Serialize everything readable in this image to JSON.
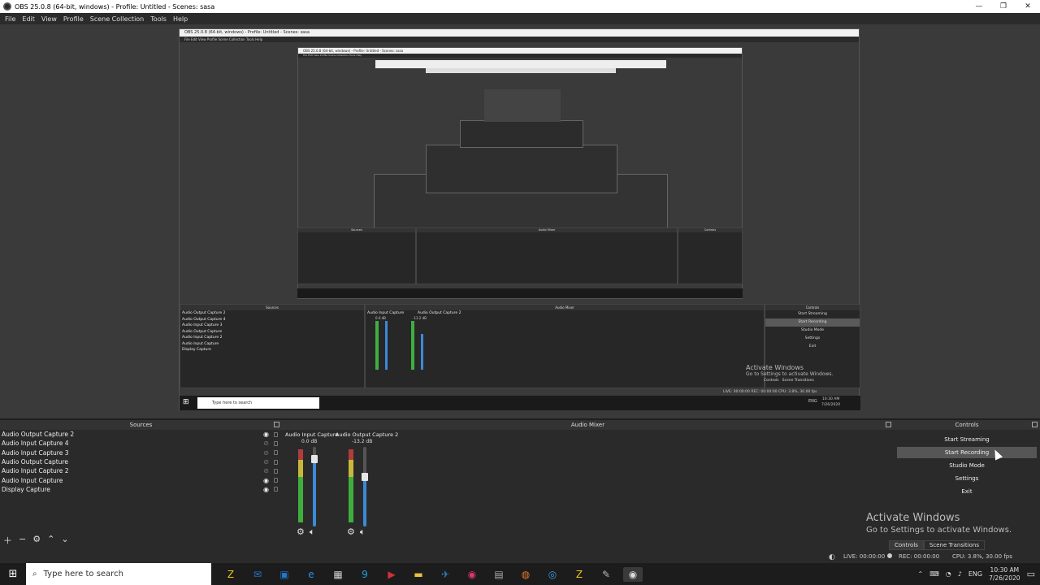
{
  "window": {
    "title": "OBS 25.0.8 (64-bit, windows) - Profile: Untitled - Scenes: sasa",
    "controls": [
      "—",
      "❐",
      "✕"
    ]
  },
  "menu": [
    "File",
    "Edit",
    "View",
    "Profile",
    "Scene Collection",
    "Tools",
    "Help"
  ],
  "nested": {
    "title": "OBS 25.0.8 (64-bit, windows) - Profile: Untitled - Scenes: sasa",
    "menu": "File  Edit  View  Profile  Scene Collection  Tools  Help",
    "sources_header": "Sources",
    "mixer_header": "Audio Mixer",
    "controls_header": "Controls",
    "sources": [
      "Audio Output Capture 2",
      "Audio Output Capture 4",
      "Audio Input Capture 3",
      "Audio Output Capture",
      "Audio Input Capture 2",
      "Audio Input Capture",
      "Display Capture"
    ],
    "channels": [
      {
        "name": "Audio Input Capture",
        "db": "0.0 dB"
      },
      {
        "name": "Audio Output Capture 2",
        "db": "-13.2 dB"
      }
    ],
    "buttons": [
      "Start Streaming",
      "Start Recording",
      "Studio Mode",
      "Settings",
      "Exit"
    ],
    "activate_title": "Activate Windows",
    "activate_sub": "Go to Settings to activate Windows.",
    "tabs": [
      "Controls",
      "Scene Transitions"
    ],
    "status": "LIVE: 00:00:00   REC: 00:00:00   CPU: 3.8%, 30.00 fps",
    "search": "Type here to search",
    "tray": "ENG",
    "time": "10:30 AM",
    "date": "7/26/2020"
  },
  "sources": {
    "header": "Sources",
    "items": [
      "Audio Output Capture 2",
      "Audio Input Capture 4",
      "Audio Input Capture 3",
      "Audio Output Capture",
      "Audio Input Capture 2",
      "Audio Input Capture",
      "Display Capture"
    ],
    "visible": [
      true,
      false,
      false,
      false,
      false,
      true,
      true
    ]
  },
  "mixer": {
    "header": "Audio Mixer",
    "channels": [
      {
        "name": "Audio Input Capture",
        "db": "0.0 dB",
        "level": 0.85
      },
      {
        "name": "Audio Output Capture 2",
        "db": "-13.2 dB",
        "level": 0.62
      }
    ]
  },
  "controls": {
    "header": "Controls",
    "buttons": [
      "Start Streaming",
      "Start Recording",
      "Studio Mode",
      "Settings",
      "Exit"
    ]
  },
  "status": {
    "tabs": [
      "Controls",
      "Scene Transitions"
    ],
    "live": "LIVE: 00:00:00",
    "rec": "REC: 00:00:00",
    "cpu": "CPU: 3.8%, 30.00 fps"
  },
  "activate": {
    "title": "Activate Windows",
    "subtitle": "Go to Settings to activate Windows."
  },
  "taskbar": {
    "search_placeholder": "Type here to search",
    "lang": "ENG",
    "time": "10:30 AM",
    "date": "7/26/2020",
    "icons": [
      {
        "name": "zoom-icon",
        "color": "#f0c419",
        "glyph": "Z"
      },
      {
        "name": "mail-icon",
        "color": "#1f78d1",
        "glyph": "✉"
      },
      {
        "name": "store-icon",
        "color": "#1f78d1",
        "glyph": "▣"
      },
      {
        "name": "edge-icon",
        "color": "#2b8fe3",
        "glyph": "e"
      },
      {
        "name": "calculator-icon",
        "color": "#cfcfcf",
        "glyph": "▦"
      },
      {
        "name": "app-9-icon",
        "color": "#1ea0e0",
        "glyph": "9"
      },
      {
        "name": "media-icon",
        "color": "#d0303a",
        "glyph": "▶"
      },
      {
        "name": "folder-icon",
        "color": "#e7c244",
        "glyph": "▬"
      },
      {
        "name": "steam-icon",
        "color": "#2e7fc4",
        "glyph": "✈"
      },
      {
        "name": "recorder-icon",
        "color": "#e0376e",
        "glyph": "◉"
      },
      {
        "name": "notes-icon",
        "color": "#aaaaaa",
        "glyph": "▤"
      },
      {
        "name": "firefox-icon",
        "color": "#e57a2b",
        "glyph": "◍"
      },
      {
        "name": "browser-icon",
        "color": "#3b9be8",
        "glyph": "◎"
      },
      {
        "name": "zoom2-icon",
        "color": "#f0c419",
        "glyph": "Z"
      },
      {
        "name": "tool-icon",
        "color": "#bbbbbb",
        "glyph": "✎"
      },
      {
        "name": "obs-icon",
        "color": "#dddddd",
        "glyph": "◉"
      }
    ]
  }
}
